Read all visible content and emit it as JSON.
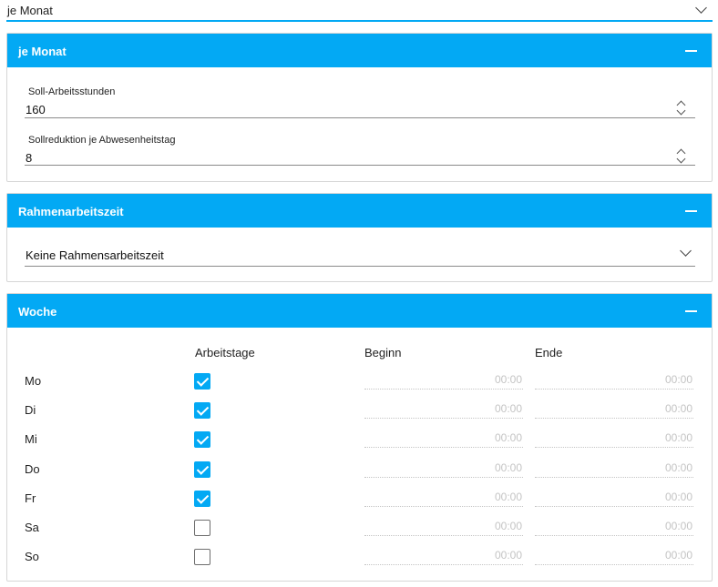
{
  "top_select": {
    "value": "je Monat"
  },
  "panel_month": {
    "title": "je Monat",
    "fields": [
      {
        "label": "Soll-Arbeitsstunden",
        "value": "160"
      },
      {
        "label": "Sollreduktion je Abwesenheitstag",
        "value": "8"
      }
    ]
  },
  "panel_frame": {
    "title": "Rahmenarbeitszeit",
    "select_value": "Keine Rahmensarbeitszeit"
  },
  "panel_week": {
    "title": "Woche",
    "columns": {
      "workdays": "Arbeitstage",
      "begin": "Beginn",
      "end": "Ende"
    },
    "days": [
      {
        "label": "Mo",
        "checked": true,
        "begin": "00:00",
        "end": "00:00"
      },
      {
        "label": "Di",
        "checked": true,
        "begin": "00:00",
        "end": "00:00"
      },
      {
        "label": "Mi",
        "checked": true,
        "begin": "00:00",
        "end": "00:00"
      },
      {
        "label": "Do",
        "checked": true,
        "begin": "00:00",
        "end": "00:00"
      },
      {
        "label": "Fr",
        "checked": true,
        "begin": "00:00",
        "end": "00:00"
      },
      {
        "label": "Sa",
        "checked": false,
        "begin": "00:00",
        "end": "00:00"
      },
      {
        "label": "So",
        "checked": false,
        "begin": "00:00",
        "end": "00:00"
      }
    ]
  },
  "colors": {
    "accent": "#03a9f4",
    "border": "#d6d6d6",
    "placeholder": "#c4c4c4"
  }
}
